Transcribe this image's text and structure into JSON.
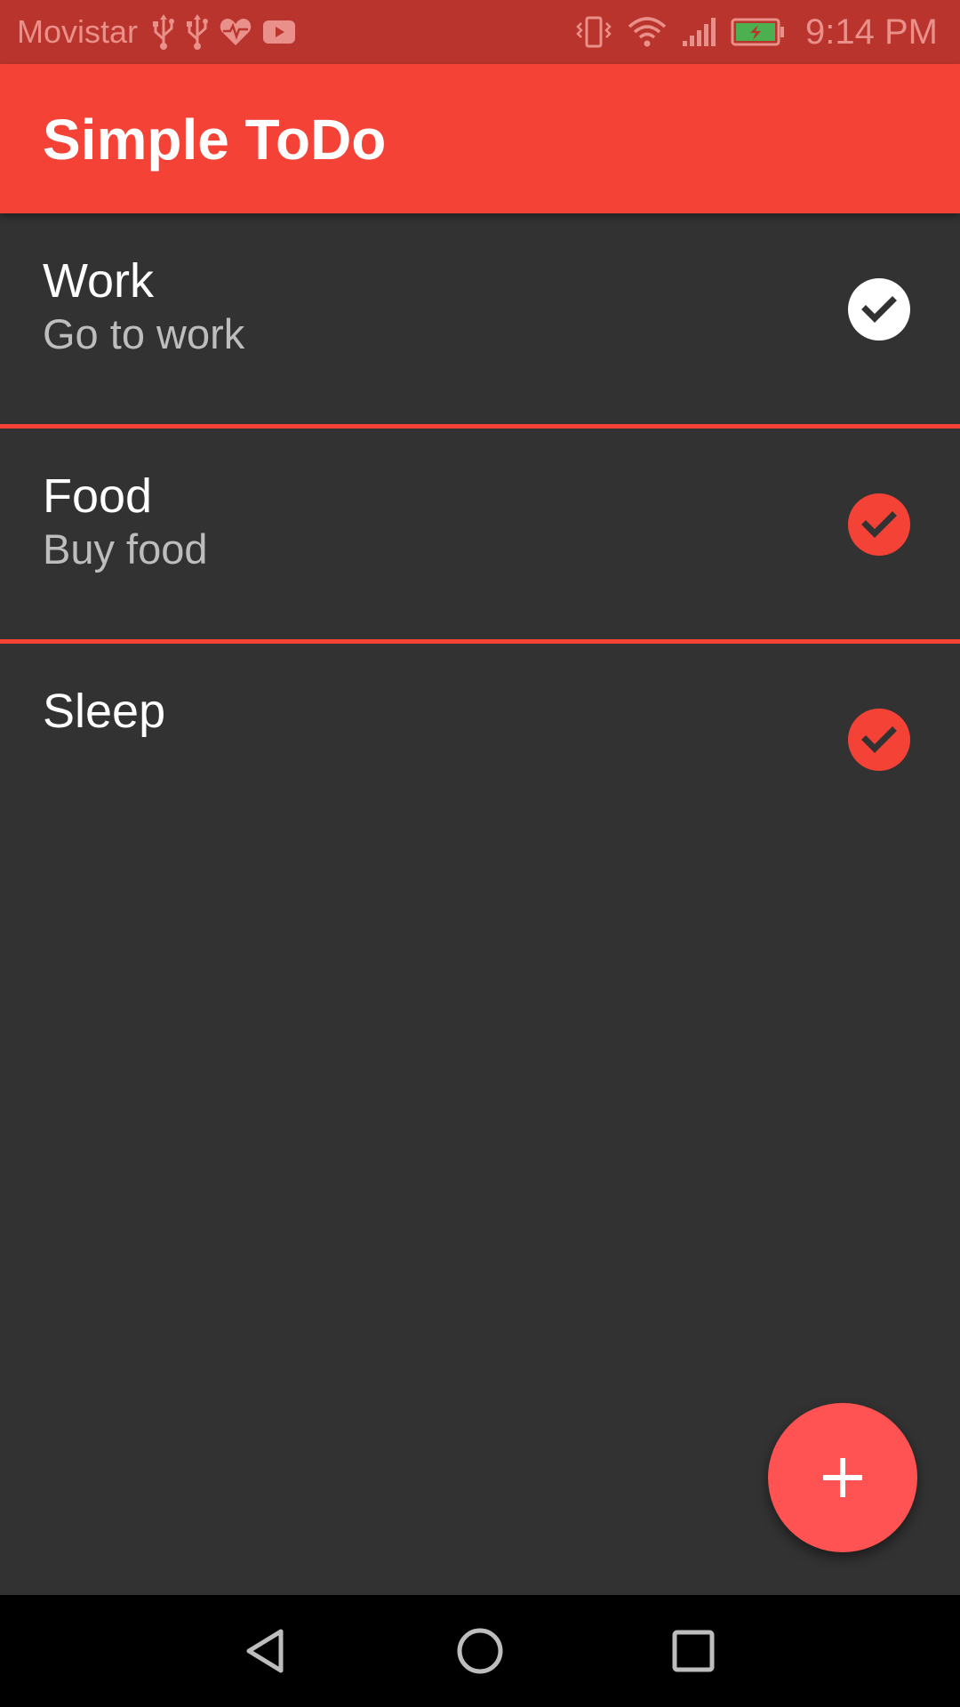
{
  "status_bar": {
    "carrier": "Movistar",
    "time": "9:14 PM",
    "left_icons": [
      "usb-icon",
      "usb-icon",
      "heart-rate-icon",
      "youtube-icon"
    ],
    "right_icons": [
      "vibrate-icon",
      "wifi-icon",
      "signal-icon",
      "battery-charging-icon"
    ]
  },
  "app_bar": {
    "title": "Simple ToDo"
  },
  "todos": [
    {
      "title": "Work",
      "description": "Go to work",
      "done": true,
      "check_color": "#FFFFFF"
    },
    {
      "title": "Food",
      "description": "Buy food",
      "done": false,
      "check_color": "#F44336"
    },
    {
      "title": "Sleep",
      "description": "",
      "done": false,
      "check_color": "#F44336"
    }
  ],
  "fab": {
    "icon": "plus-icon"
  },
  "nav_bar": {
    "buttons": [
      "back-icon",
      "home-icon",
      "recents-icon"
    ]
  },
  "colors": {
    "primary": "#F44336",
    "primary_dark": "#B9342C",
    "accent": "#FF5252",
    "background": "#323232"
  }
}
